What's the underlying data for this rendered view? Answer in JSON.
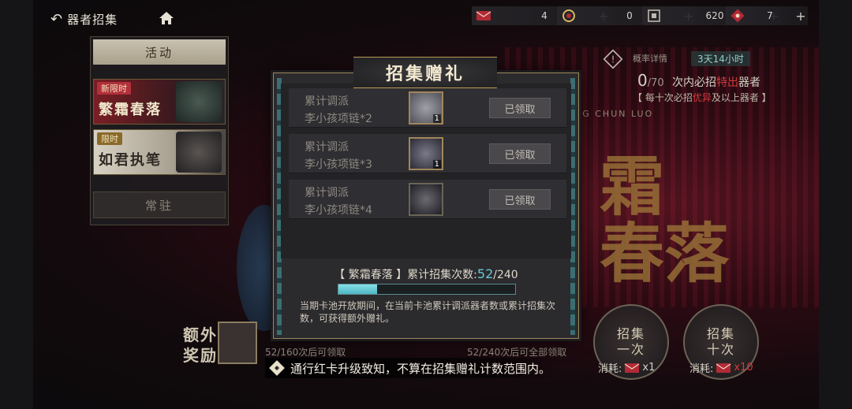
{
  "header": {
    "back_label": "器者招集",
    "resources": [
      {
        "icon": "red-envelope-icon",
        "value": "4"
      },
      {
        "icon": "coin-stack-icon",
        "value": "0"
      },
      {
        "icon": "ticket-icon",
        "value": "620"
      },
      {
        "icon": "red-token-icon",
        "value": "7"
      }
    ]
  },
  "sidebar": {
    "activity_tab": "活动",
    "banners": [
      {
        "tag": "新限时",
        "title": "繁霜春落"
      },
      {
        "tag": "限时",
        "title": "如君执笔"
      }
    ],
    "normal_tab": "常驻"
  },
  "pool_info": {
    "rate_label": "概率详情",
    "timer": "3天14小时",
    "pity_current": "0",
    "pity_total": "/70",
    "pity_text_a": "次内必招",
    "pity_text_hl": "特出",
    "pity_text_b": "器者",
    "pity_note_a": "【 每十次必招",
    "pity_note_hl": "优异",
    "pity_note_b": "及以上器者 】",
    "banner_big_line1": "霜",
    "banner_big_line2": "春落",
    "banner_en": "NG CHUN LUO"
  },
  "modal": {
    "title": "招集赠礼",
    "rows": [
      {
        "line1": "累计调派",
        "line2": "李小孩项链*2",
        "qty": "1",
        "status": "已领取"
      },
      {
        "line1": "累计调派",
        "line2": "李小孩项链*3",
        "qty": "1",
        "status": "已领取"
      },
      {
        "line1": "累计调派",
        "line2": "李小孩项链*4",
        "qty": "",
        "status": "已领取"
      }
    ],
    "progress_prefix": "【 繁霜春落 】累计招集次数:",
    "progress_current": "52",
    "progress_total": "/240",
    "progress_fraction": 0.217,
    "description": "当期卡池开放期间，在当前卡池累计调派器者数或累计招集次数，可获得额外赠礼。"
  },
  "bottom": {
    "extra_label_1": "额外",
    "extra_label_2": "奖励",
    "progress_160": "52/160次后可领取",
    "progress_240": "52/240次后可全部领取",
    "summon_once": {
      "line1": "招集",
      "line2": "一次",
      "cost_label": "消耗:",
      "cost": "x1"
    },
    "summon_ten": {
      "line1": "招集",
      "line2": "十次",
      "cost_label": "消耗:",
      "cost": "x10"
    },
    "tip": "通行红卡升级致知，不算在招集赠礼计数范围内。"
  },
  "colors": {
    "accent_cyan": "#66c8d6",
    "highlight_red": "#d63a3a",
    "gold": "#b79a55"
  }
}
